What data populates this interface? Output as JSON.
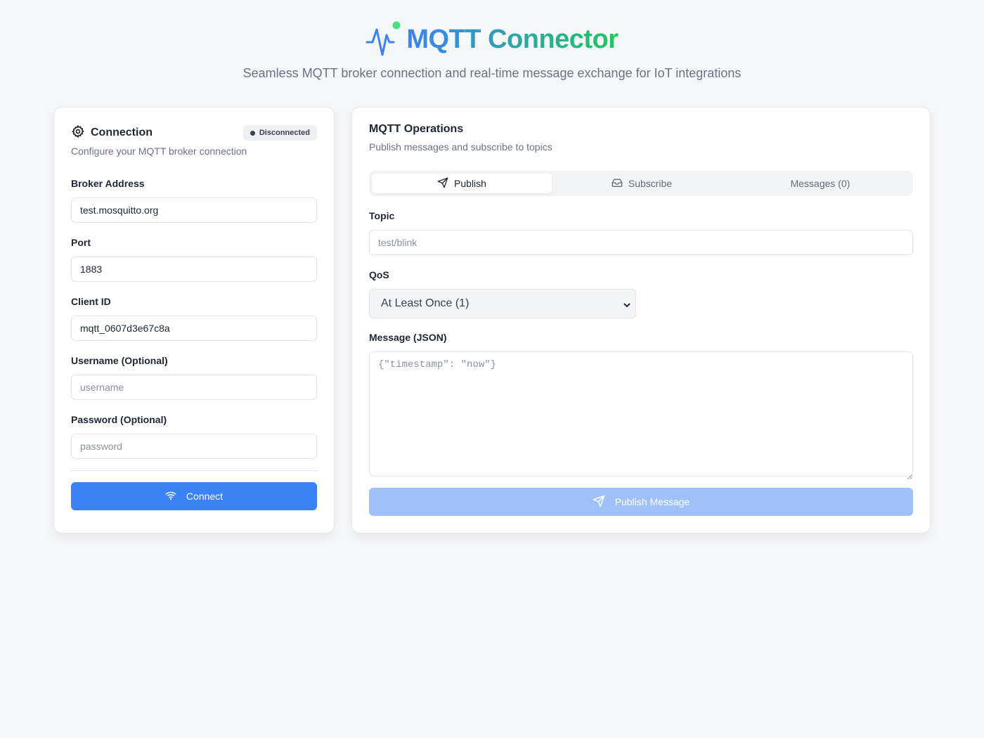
{
  "header": {
    "title": "MQTT Connector",
    "subtitle": "Seamless MQTT broker connection and real-time message exchange for IoT integrations",
    "logo_icon": "activity-pulse-icon"
  },
  "connection": {
    "title": "Connection",
    "status": "Disconnected",
    "description": "Configure your MQTT broker connection",
    "broker": {
      "label": "Broker Address",
      "value": "test.mosquitto.org"
    },
    "port": {
      "label": "Port",
      "value": "1883"
    },
    "client_id": {
      "label": "Client ID",
      "value": "mqtt_0607d3e67c8a"
    },
    "username": {
      "label": "Username (Optional)",
      "placeholder": "username"
    },
    "password": {
      "label": "Password (Optional)",
      "placeholder": "password"
    },
    "connect_label": "Connect"
  },
  "operations": {
    "title": "MQTT Operations",
    "description": "Publish messages and subscribe to topics",
    "tabs": [
      {
        "label": "Publish",
        "icon": "send-icon",
        "active": true
      },
      {
        "label": "Subscribe",
        "icon": "inbox-icon",
        "active": false
      },
      {
        "label": "Messages (0)",
        "icon": "",
        "active": false
      }
    ],
    "topic": {
      "label": "Topic",
      "placeholder": "test/blink"
    },
    "qos": {
      "label": "QoS",
      "selected": "At Least Once (1)"
    },
    "message": {
      "label": "Message (JSON)",
      "placeholder": "{\"timestamp\": \"now\"}"
    },
    "publish_label": "Publish Message"
  },
  "colors": {
    "accent": "#3b82f6",
    "accent_disabled": "#9fc1f8",
    "gradient_end": "#22c55e",
    "background": "#f5f6f8"
  }
}
